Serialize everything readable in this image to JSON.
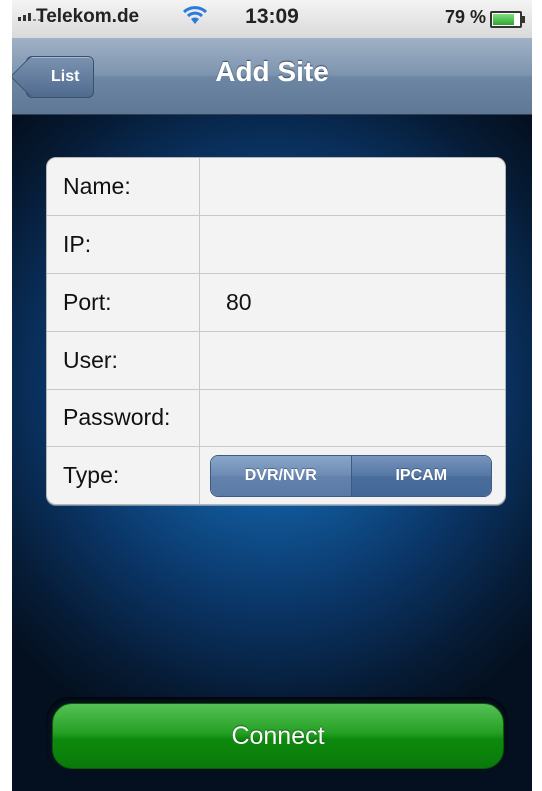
{
  "status_bar": {
    "carrier": "Telekom.de",
    "time": "13:09",
    "battery_text": "79 %",
    "battery_level": 0.79,
    "icons": [
      "signal-icon",
      "wifi-icon",
      "battery-icon"
    ]
  },
  "nav": {
    "back_label": "List",
    "title": "Add Site"
  },
  "form": {
    "rows": [
      {
        "label": "Name:",
        "value": ""
      },
      {
        "label": "IP:",
        "value": ""
      },
      {
        "label": "Port:",
        "value": "80"
      },
      {
        "label": "User:",
        "value": ""
      },
      {
        "label": "Password:",
        "value": ""
      },
      {
        "label": "Type:"
      }
    ],
    "type_options": [
      "DVR/NVR",
      "IPCAM"
    ]
  },
  "connect_label": "Connect",
  "colors": {
    "connect_green": "#1a9a1a",
    "nav_blue": "#7e95af",
    "segment_blue": "#5b7ba6"
  }
}
